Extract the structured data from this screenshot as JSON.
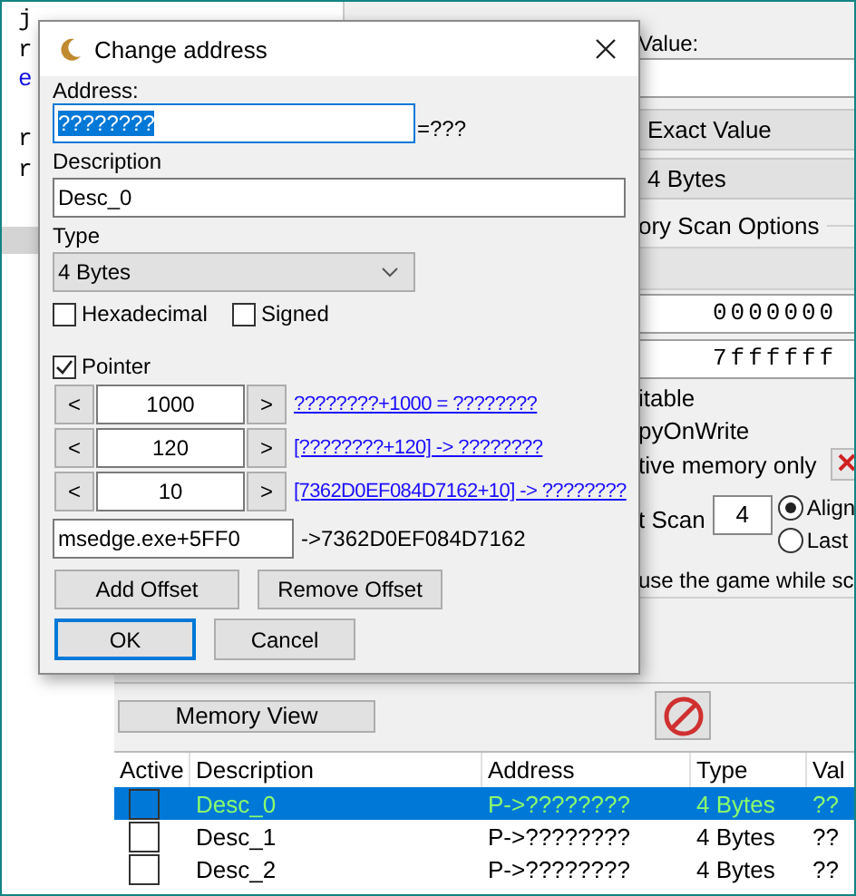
{
  "code_editor": {
    "lines": [
      {
        "text": "j",
        "kind": "text"
      },
      {
        "text": "r",
        "kind": "text"
      },
      {
        "text": "e",
        "kind": "keyword"
      },
      {
        "text": "r",
        "kind": "text"
      },
      {
        "text": "r",
        "kind": "text"
      }
    ]
  },
  "scan_panel": {
    "value_label": "Value:",
    "scan_type": "Exact Value",
    "value_type": "4 Bytes",
    "options_title": "ory Scan Options",
    "start_address": "0000000",
    "stop_address": "7ffffff",
    "writable_label": "itable",
    "copy_on_write_label": "pyOnWrite",
    "active_memory_label": "tive memory only",
    "fast_scan_label": "t Scan",
    "fast_scan_value": "4",
    "alignment": [
      {
        "label": "Align",
        "selected": true
      },
      {
        "label": "Last",
        "selected": false
      }
    ],
    "pause_label": "use the game while sc"
  },
  "memory_view_button": "Memory View",
  "address_table": {
    "columns": [
      "Active",
      "Description",
      "Address",
      "Type",
      "Val"
    ],
    "rows": [
      {
        "active": false,
        "description": "Desc_0",
        "address": "P->????????",
        "type": "4 Bytes",
        "value": "??",
        "selected": true
      },
      {
        "active": false,
        "description": "Desc_1",
        "address": "P->????????",
        "type": "4 Bytes",
        "value": "??",
        "selected": false
      },
      {
        "active": false,
        "description": "Desc_2",
        "address": "P->????????",
        "type": "4 Bytes",
        "value": "??",
        "selected": false
      }
    ]
  },
  "dialog": {
    "title": "Change address",
    "address_label": "Address:",
    "address_value": "????????",
    "address_result": "=???",
    "description_label": "Description",
    "description_value": "Desc_0",
    "type_label": "Type",
    "type_value": "4 Bytes",
    "options": [
      {
        "label": "Hexadecimal",
        "checked": false
      },
      {
        "label": "Signed",
        "checked": false
      }
    ],
    "pointer": {
      "label": "Pointer",
      "checked": true
    },
    "offsets": [
      {
        "decrement": "<",
        "value": "1000",
        "increment": ">",
        "link": "????????+1000 = ????????"
      },
      {
        "decrement": "<",
        "value": "120",
        "increment": ">",
        "link": "[????????+120] -> ????????"
      },
      {
        "decrement": "<",
        "value": "10",
        "increment": ">",
        "link": "[7362D0EF084D7162+10] -> ????????"
      }
    ],
    "base_address": "msedge.exe+5FF0",
    "base_result": "->7362D0EF084D7162",
    "offset_buttons": [
      "Add Offset",
      "Remove Offset"
    ],
    "buttons": [
      {
        "label": "OK",
        "default": true
      },
      {
        "label": "Cancel",
        "default": false
      }
    ]
  }
}
